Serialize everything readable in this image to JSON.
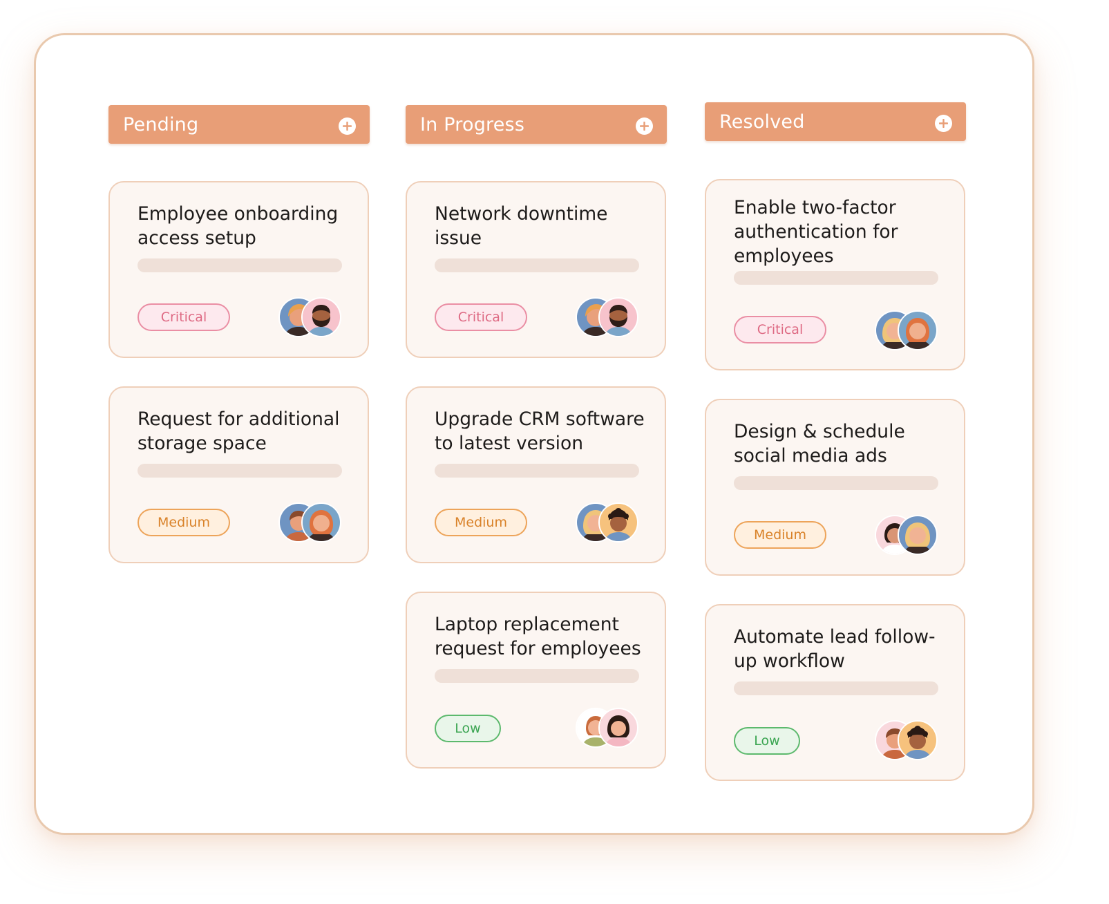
{
  "board": {
    "columns": [
      {
        "title": "Pending",
        "add_icon": "plus-circle-icon",
        "cards": [
          {
            "title": "Employee onboarding access setup",
            "priority": "Critical",
            "priority_level": "critical",
            "assignees": [
              "woman-curly-hair-avatar",
              "bearded-man-avatar"
            ]
          },
          {
            "title": "Request for additional storage space",
            "priority": "Medium",
            "priority_level": "medium",
            "assignees": [
              "man-brown-hair-avatar",
              "woman-ginger-hair-avatar"
            ]
          }
        ]
      },
      {
        "title": "In Progress",
        "add_icon": "plus-circle-icon",
        "cards": [
          {
            "title": "Network downtime issue",
            "priority": "Critical",
            "priority_level": "critical",
            "assignees": [
              "woman-curly-hair-avatar",
              "bearded-man-avatar"
            ]
          },
          {
            "title": "Upgrade CRM software to latest version",
            "priority": "Medium",
            "priority_level": "medium",
            "assignees": [
              "woman-blonde-hair-avatar",
              "man-curly-hair-avatar"
            ]
          },
          {
            "title": "Laptop replacement request for employees",
            "priority": "Low",
            "priority_level": "low",
            "assignees": [
              "woman-red-hair-avatar",
              "woman-dark-curly-hair-avatar"
            ]
          }
        ]
      },
      {
        "title": "Resolved",
        "add_icon": "plus-circle-icon",
        "cards": [
          {
            "title": "Enable two-factor authentication for employees",
            "priority": "Critical",
            "priority_level": "critical",
            "assignees": [
              "woman-blonde-hair-avatar",
              "woman-ginger-hair-avatar"
            ]
          },
          {
            "title": "Design & schedule social media ads",
            "priority": "Medium",
            "priority_level": "medium",
            "assignees": [
              "woman-dark-hair-avatar",
              "woman-blonde-hair-avatar"
            ]
          },
          {
            "title": "Automate lead follow-up workflow",
            "priority": "Low",
            "priority_level": "low",
            "assignees": [
              "man-brown-hair-avatar",
              "man-curly-hair-avatar"
            ]
          }
        ]
      }
    ]
  },
  "colors": {
    "header": "#e89e77",
    "card_background": "#fcf6f2",
    "card_border": "#efcfb9",
    "critical": "#de6983",
    "medium": "#d98229",
    "low": "#3ba552"
  }
}
